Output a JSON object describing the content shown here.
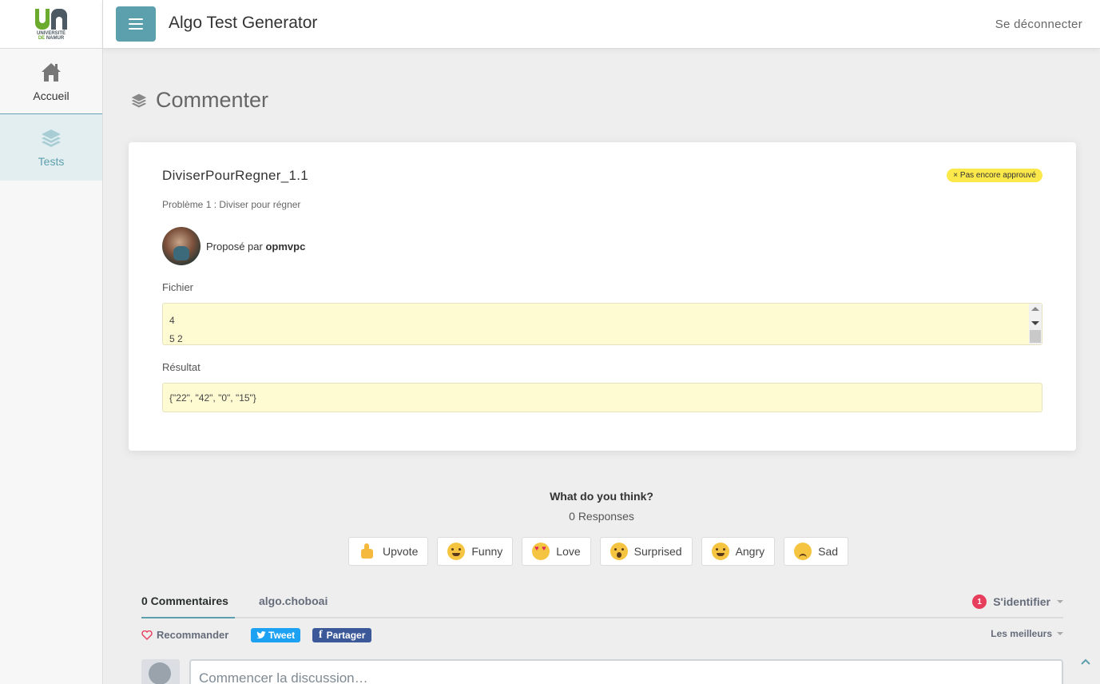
{
  "sidebar": {
    "logo_line1": "UNIVERSITÉ",
    "logo_line2_prefix": "DE",
    "logo_line2": "NAMUR",
    "items": [
      {
        "label": "Accueil",
        "icon": "home-icon"
      },
      {
        "label": "Tests",
        "icon": "layers-icon"
      }
    ]
  },
  "header": {
    "title": "Algo Test Generator",
    "logout": "Se déconnecter"
  },
  "page": {
    "title": "Commenter"
  },
  "test": {
    "name": "DiviserPourRegner_1.1",
    "status": "Pas encore approuvé",
    "status_mark": "×",
    "problem": "Problème 1 : Diviser pour régner",
    "proposed_prefix": "Proposé par",
    "author": "opmvpc",
    "file_label": "Fichier",
    "file_lines": [
      "4",
      "5 2"
    ],
    "result_label": "Résultat",
    "result_value": "{\"22\", \"42\", \"0\", \"15\"}"
  },
  "reactions": {
    "question": "What do you think?",
    "responses": "0 Responses",
    "items": [
      {
        "label": "Upvote",
        "icon": "thumbs-up-icon"
      },
      {
        "label": "Funny",
        "icon": "funny-face-icon"
      },
      {
        "label": "Love",
        "icon": "heart-eyes-icon"
      },
      {
        "label": "Surprised",
        "icon": "surprised-face-icon"
      },
      {
        "label": "Angry",
        "icon": "angry-face-icon"
      },
      {
        "label": "Sad",
        "icon": "sad-face-icon"
      }
    ]
  },
  "comments": {
    "count_tab": "0 Commentaires",
    "forum_tab": "algo.choboai",
    "notif_count": "1",
    "login": "S'identifier",
    "recommend": "Recommander",
    "tweet": "Tweet",
    "share": "Partager",
    "sort": "Les meilleurs",
    "placeholder": "Commencer la discussion…"
  },
  "colors": {
    "accent": "#5c9fad",
    "badge": "#fbe94b",
    "field_bg": "#fefbd3",
    "tweet": "#1da1f2",
    "facebook": "#3b5998",
    "notif": "#e63e5c"
  }
}
